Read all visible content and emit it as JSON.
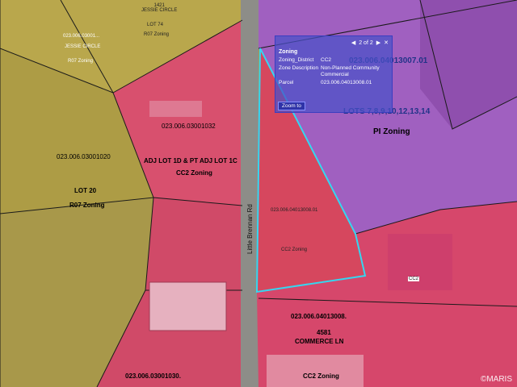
{
  "popup": {
    "pager": "2 of 2",
    "title": "Zoning",
    "rows": [
      {
        "key": "Zoning_District",
        "value": "CC2"
      },
      {
        "key": "Zone Description",
        "value": "Non-Planned Community Commercial"
      },
      {
        "key": "Parcel",
        "value": "023.006.04013008.01"
      }
    ],
    "zoom_label": "Zoom to"
  },
  "labels": {
    "top_circle": "1421\nJESSIE CIRCLE",
    "top_lot": "LOT 74",
    "r07_top": "R07 Zoning",
    "left_small1": "023.006.03001...",
    "left_small2": "JESSIE CIRCLE",
    "r07_small": "R07 Zoning",
    "parcel_032": "023.006.03001032",
    "adj_lot": "ADJ LOT 1D & PT ADJ LOT 1C",
    "cc2_1": "CC2 Zoning",
    "parcel_020": "023.006.03001020",
    "lot20": "LOT 20",
    "r07_mid": "R07 Zoning",
    "road_name": "Little Brennan Rd",
    "parcel_008_01": "023.006.04013008.01",
    "cc2_2": "CC2 Zoning",
    "parcel_007": "023.006.04013007.01",
    "lots_list": "LOTS 7,8,9,10,12,13,14",
    "pi_zoning": "PI Zoning",
    "cc2_small": "CC2",
    "parcel_008": "023.006.04013008.",
    "address_num": "4581",
    "address_street": "COMMERCE LN",
    "cc2_3": "CC2 Zoning",
    "parcel_030": "023.006.03001030.",
    "watermark": "©MARIS"
  },
  "colors": {
    "r07": "#b8a54a",
    "cc2": "#d9476a",
    "pi": "#a566c8",
    "road": "#8a8a8a",
    "selection": "#35d6f0",
    "popup_bg": "#4850c8"
  }
}
